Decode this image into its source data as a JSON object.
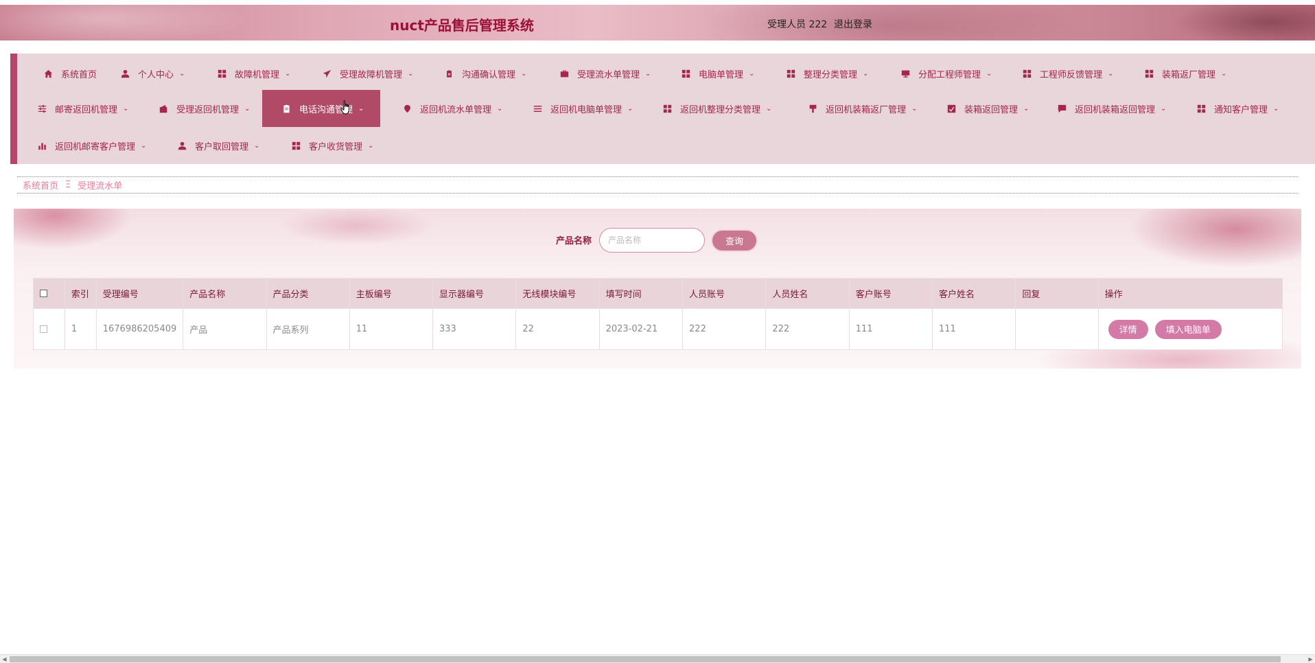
{
  "header": {
    "title": "nuct产品售后管理系统",
    "user_label": "受理人员 222",
    "logout_label": "退出登录"
  },
  "nav": {
    "items": [
      {
        "label": "系统首页",
        "icon": "home-icon",
        "dropdown": false
      },
      {
        "label": "个人中心",
        "icon": "user-icon",
        "dropdown": true
      },
      {
        "label": "故障机管理",
        "icon": "grid-icon",
        "dropdown": true
      },
      {
        "label": "受理故障机管理",
        "icon": "paper-plane-icon",
        "dropdown": true
      },
      {
        "label": "沟通确认管理",
        "icon": "clipboard-x-icon",
        "dropdown": true
      },
      {
        "label": "受理流水单管理",
        "icon": "briefcase-icon",
        "dropdown": true
      },
      {
        "label": "电脑单管理",
        "icon": "grid-icon",
        "dropdown": true
      },
      {
        "label": "整理分类管理",
        "icon": "grid-icon",
        "dropdown": true
      },
      {
        "label": "分配工程师管理",
        "icon": "monitor-icon",
        "dropdown": true
      },
      {
        "label": "工程师反馈管理",
        "icon": "grid-icon",
        "dropdown": true
      },
      {
        "label": "装箱返厂管理",
        "icon": "grid-icon",
        "dropdown": true
      },
      {
        "label": "邮寄返回机管理",
        "icon": "sliders-icon",
        "dropdown": true
      },
      {
        "label": "受理返回机管理",
        "icon": "wallet-icon",
        "dropdown": true
      },
      {
        "label": "电话沟通管理",
        "icon": "clipboard-icon",
        "dropdown": true,
        "active": true
      },
      {
        "label": "返回机流水单管理",
        "icon": "map-pin-icon",
        "dropdown": true
      },
      {
        "label": "返回机电脑单管理",
        "icon": "list-icon",
        "dropdown": true
      },
      {
        "label": "返回机整理分类管理",
        "icon": "grid-icon",
        "dropdown": true
      },
      {
        "label": "返回机装箱返厂管理",
        "icon": "brush-icon",
        "dropdown": true
      },
      {
        "label": "装箱返回管理",
        "icon": "chart-check-icon",
        "dropdown": true
      },
      {
        "label": "返回机装箱返回管理",
        "icon": "chat-icon",
        "dropdown": true
      },
      {
        "label": "通知客户管理",
        "icon": "grid-icon",
        "dropdown": true
      },
      {
        "label": "返回机邮寄客户管理",
        "icon": "bar-chart-icon",
        "dropdown": true
      },
      {
        "label": "客户取回管理",
        "icon": "user-icon",
        "dropdown": true
      },
      {
        "label": "客户收货管理",
        "icon": "grid-icon",
        "dropdown": true
      }
    ]
  },
  "breadcrumb": {
    "home": "系统首页",
    "separator": "Ξ",
    "current": "受理流水单"
  },
  "search": {
    "label": "产品名称",
    "placeholder": "产品名称",
    "button": "查询"
  },
  "table": {
    "columns": [
      "索引",
      "受理编号",
      "产品名称",
      "产品分类",
      "主板编号",
      "显示器编号",
      "无线模块编号",
      "填写时间",
      "人员账号",
      "人员姓名",
      "客户账号",
      "客户姓名",
      "回复",
      "操作"
    ],
    "rows": [
      {
        "index": "1",
        "accept_no": "1676986205409",
        "product_name": "产品",
        "product_category": "产品系列",
        "board_no": "11",
        "display_no": "333",
        "wireless_no": "22",
        "fill_time": "2023-02-21",
        "staff_account": "222",
        "staff_name": "222",
        "customer_account": "111",
        "customer_name": "111",
        "reply": "",
        "actions": [
          "详情",
          "填入电脑单"
        ]
      }
    ]
  },
  "colors": {
    "accent": "#b04a67",
    "title": "#9b1035",
    "nav_bg": "#e8d6db",
    "button": "#d37aa6"
  }
}
